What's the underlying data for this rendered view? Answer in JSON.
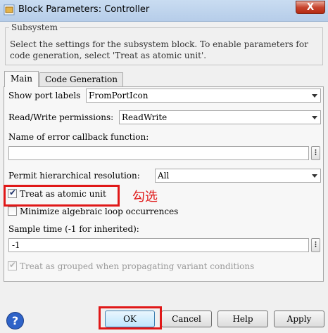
{
  "window": {
    "title": "Block Parameters: Controller",
    "close_label": "X"
  },
  "subsystem": {
    "legend": "Subsystem",
    "description": "Select the settings for the subsystem block. To enable parameters for code generation, select 'Treat as atomic unit'."
  },
  "tabs": [
    {
      "label": "Main"
    },
    {
      "label": "Code Generation"
    }
  ],
  "fields": {
    "show_port_labels": {
      "label": "Show port labels",
      "value": "FromPortIcon"
    },
    "rw_permissions": {
      "label": "Read/Write permissions:",
      "value": "ReadWrite"
    },
    "error_callback": {
      "label": "Name of error callback function:",
      "value": ""
    },
    "permit_hier": {
      "label": "Permit hierarchical resolution:",
      "value": "All"
    },
    "treat_atomic": {
      "label": "Treat as atomic unit",
      "checked": true
    },
    "minimize_loop": {
      "label": "Minimize algebraic loop occurrences",
      "checked": false
    },
    "sample_time": {
      "label": "Sample time (-1 for inherited):",
      "value": "-1"
    },
    "treat_grouped": {
      "label": "Treat as grouped when propagating variant conditions",
      "checked": true,
      "enabled": false
    }
  },
  "annotation": "勾选",
  "buttons": {
    "ok": "OK",
    "cancel": "Cancel",
    "help": "Help",
    "apply": "Apply"
  },
  "colors": {
    "highlight": "#e01818",
    "titlebar": "#c9dcf1",
    "close_button": "#c7452f"
  }
}
